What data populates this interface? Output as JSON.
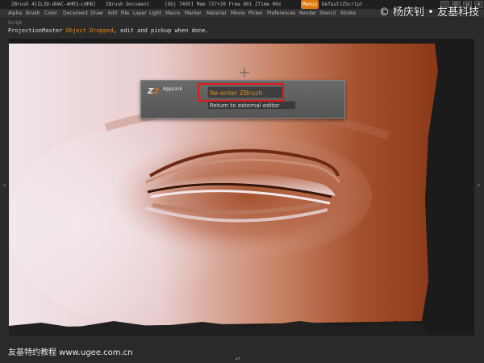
{
  "titlebar": {
    "app": "ZBrush 4[ZL3D-UHAC-AHR3-LHRB]",
    "document": "ZBrush Document",
    "status": "[Obj 7495] Mem 737+20 Free 801 ZTime 00¢",
    "menus_label": "Menus",
    "script_label": "DefaultZScript"
  },
  "menubar": {
    "items": [
      "Alpha",
      "Brush",
      "Color",
      "Document",
      "Draw",
      "Edit",
      "File",
      "Layer",
      "Light",
      "Macro",
      "Marker",
      "Material",
      "Movie",
      "Picker",
      "Preferences",
      "Render",
      "Stencil",
      "Stroke"
    ]
  },
  "watermark_top": "© 杨庆钊 • 友基科技",
  "script_area_label": "Script",
  "notice": {
    "prefix": "ProjectionMaster ",
    "highlight": "Object Dropped",
    "suffix": ", edit and pickup when done."
  },
  "applink": {
    "logo_z": "Z",
    "logo_sub": "2",
    "title": "AppLink",
    "reenter_label": "Re-enter ZBrush",
    "return_label": "Return to external editor"
  },
  "watermark_bottom": "友基特约教程 www.ugee.com.cn",
  "colors": {
    "accent": "#e08a1e",
    "highlight_box": "#e01818",
    "skin_light": "#f2e6ea",
    "skin_dark": "#8a3416"
  }
}
